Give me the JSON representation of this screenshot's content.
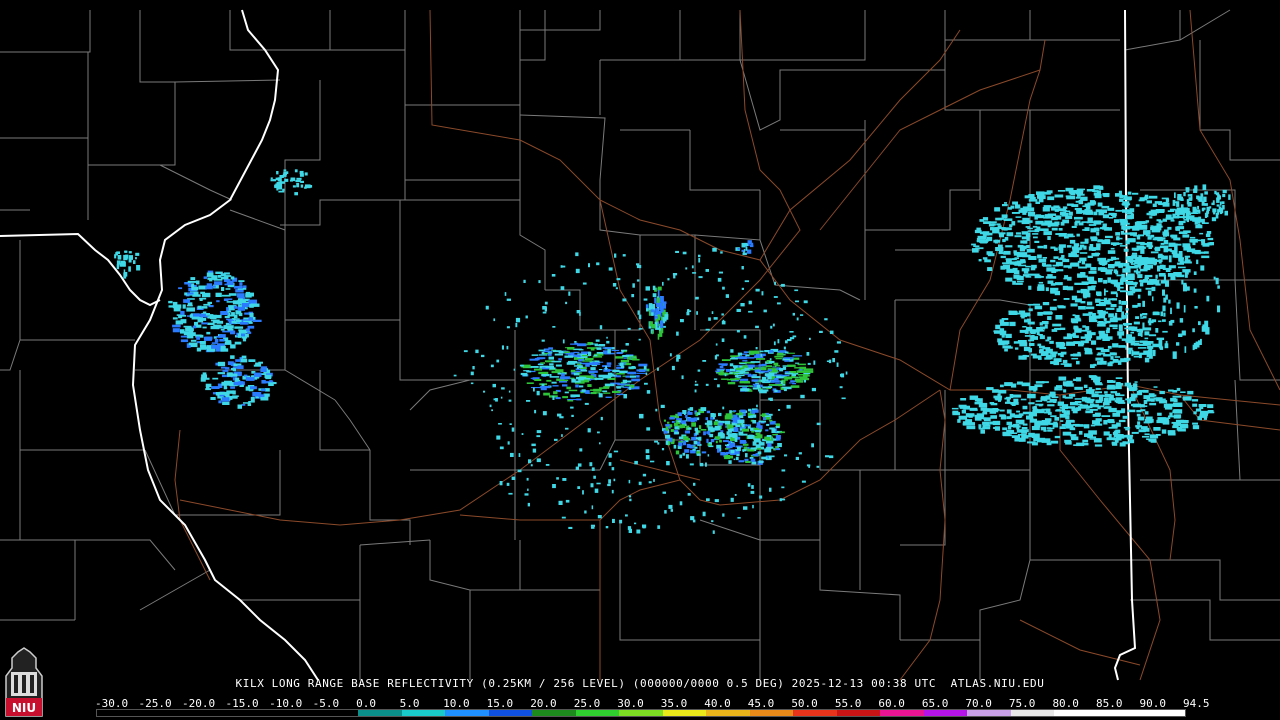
{
  "product": {
    "caption": "KILX LONG RANGE BASE REFLECTIVITY (0.25KM / 256 LEVEL) (000000/0000 0.5 DEG) 2025-12-13 00:38 UTC  ATLAS.NIU.EDU"
  },
  "logo": {
    "text": "NIU",
    "color": "#c8102e"
  },
  "color_scale": {
    "labels": [
      "-30.0",
      "-25.0",
      "-20.0",
      "-15.0",
      "-10.0",
      "-5.0",
      "0.0",
      "5.0",
      "10.0",
      "15.0",
      "20.0",
      "25.0",
      "30.0",
      "35.0",
      "40.0",
      "45.0",
      "50.0",
      "55.0",
      "60.0",
      "65.0",
      "70.0",
      "75.0",
      "80.0",
      "85.0",
      "90.0",
      "94.5"
    ],
    "colors": [
      "#000000",
      "#000000",
      "#000000",
      "#000000",
      "#000000",
      "#000000",
      "#0a8f8a",
      "#19c9c9",
      "#1e90ff",
      "#1050e0",
      "#1c8a1c",
      "#2fcf2f",
      "#7ddd23",
      "#e8e81a",
      "#e8b41a",
      "#e88a1a",
      "#e8341a",
      "#c81414",
      "#e81493",
      "#b414e8",
      "#c8a0e8",
      "#e8e8e8",
      "#ffffff",
      "#ffffff",
      "#ffffff"
    ]
  },
  "colors": {
    "background": "#000000",
    "county_lines": "#7a7a7a",
    "state_lines": "#ffffff",
    "highways": "#8b4a2a",
    "echo_light": "#3fd8e6",
    "echo_mid": "#2b7bff",
    "echo_heavy": "#2ec43a"
  }
}
